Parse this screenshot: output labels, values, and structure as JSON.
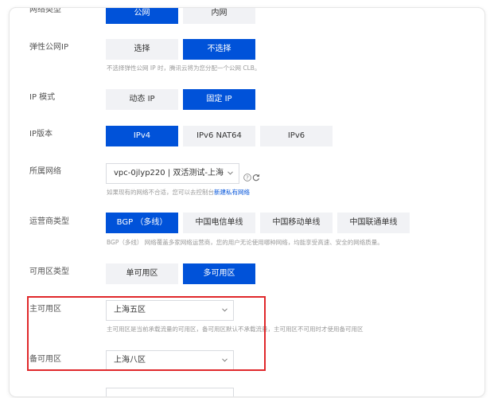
{
  "form": {
    "network_type": {
      "label": "网络类型",
      "options": [
        "公网",
        "内网"
      ]
    },
    "eip": {
      "label": "弹性公网IP",
      "options": [
        "选择",
        "不选择"
      ],
      "hint": "不选择弹性公网 IP 时，腾讯云将为您分配一个公网 CLB。"
    },
    "ip_mode": {
      "label": "IP 模式",
      "options": [
        "动态 IP",
        "固定 IP"
      ]
    },
    "ip_version": {
      "label": "IP版本",
      "options": [
        "IPv4",
        "IPv6 NAT64",
        "IPv6"
      ]
    },
    "vpc": {
      "label": "所属网络",
      "value": "vpc-0jlyp220 | 双活测试-上海",
      "hint": "如果现有的网络不合适，您可以去控制台",
      "hint_link": "新建私有网络"
    },
    "isp": {
      "label": "运营商类型",
      "options": [
        "BGP （多线）",
        "中国电信单线",
        "中国移动单线",
        "中国联通单线"
      ],
      "hint": "BGP（多线） 网络覆盖多家网络运营商，您的用户无论使用哪种网络，均能享受高速、安全的网络质量。"
    },
    "az_type": {
      "label": "可用区类型",
      "options": [
        "单可用区",
        "多可用区"
      ]
    },
    "primary_az": {
      "label": "主可用区",
      "value": "上海五区",
      "hint": "主可用区是当前承载流量的可用区，备可用区默认不承载流量，主可用区不可用时才使用备可用区"
    },
    "backup_az": {
      "label": "备可用区",
      "value": "上海八区"
    }
  },
  "colors": {
    "accent": "#0052d9",
    "highlight_box": "#e0282b"
  },
  "icons": [
    "help-icon",
    "refresh-icon",
    "chevron-down-icon"
  ]
}
